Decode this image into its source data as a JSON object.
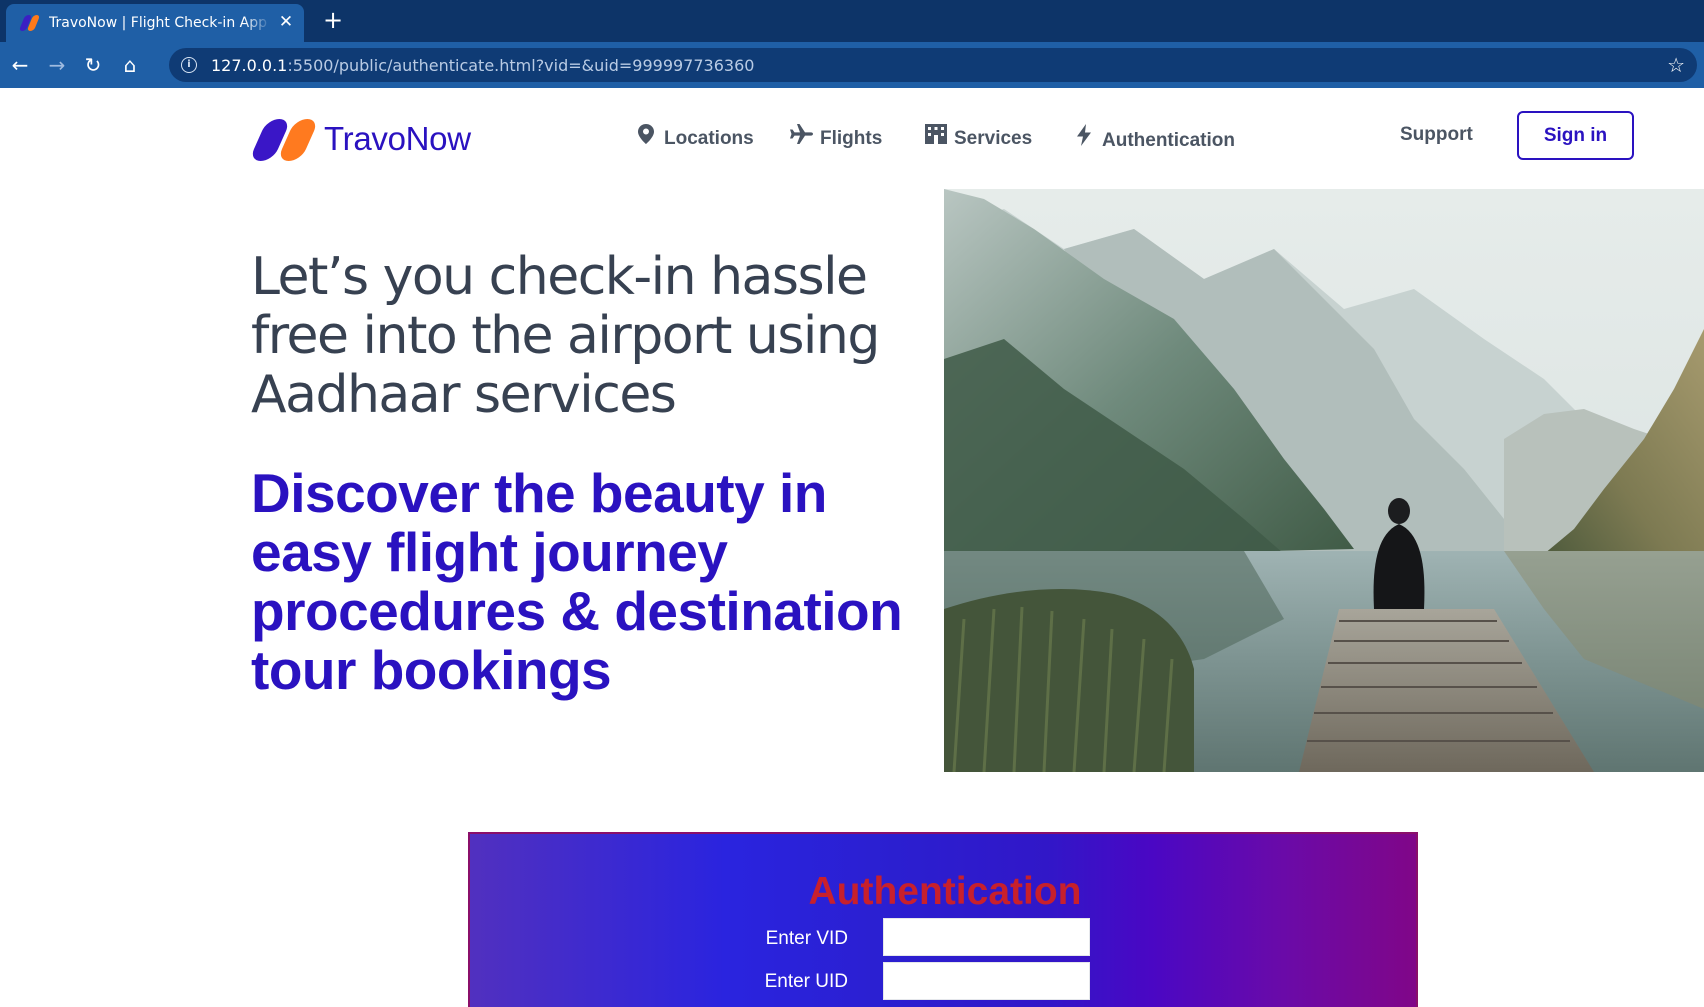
{
  "browser": {
    "tab_title": "TravoNow | Flight Check-in App & Tour Bookings",
    "close_glyph": "✕",
    "new_tab_glyph": "+",
    "url_host": "127.0.0.1",
    "url_rest": ":5500/public/authenticate.html?vid=&uid=999997736360",
    "back_glyph": "←",
    "forward_glyph": "→",
    "reload_glyph": "↻",
    "home_glyph": "⌂",
    "star_glyph": "☆"
  },
  "header": {
    "brand": "TravoNow",
    "nav": [
      {
        "label": "Locations",
        "icon": "map-pin-icon",
        "glyph": "📍"
      },
      {
        "label": "Flights",
        "icon": "airplane-icon",
        "glyph": "✈"
      },
      {
        "label": "Services",
        "icon": "building-icon",
        "glyph": "▦"
      },
      {
        "label": "Authentication",
        "icon": "lightning-icon",
        "glyph": "ϟ"
      }
    ],
    "support": "Support",
    "sign_in": "Sign in"
  },
  "hero": {
    "title": "Let’s you check-in hassle free into the airport using Aadhaar services",
    "subtitle": "Discover the beauty in easy flight journey procedures & destination tour bookings",
    "image_icon": "mountain-lake-landscape"
  },
  "auth": {
    "title": "Authentication",
    "vid_label": "Enter VID",
    "vid_value": "",
    "uid_label": "Enter UID",
    "uid_value": ""
  },
  "colors": {
    "brand_primary": "#2a12c0",
    "brand_accent": "#ff7a1f",
    "auth_title": "#c8202c",
    "browser_chrome": "#1f5fa6"
  }
}
